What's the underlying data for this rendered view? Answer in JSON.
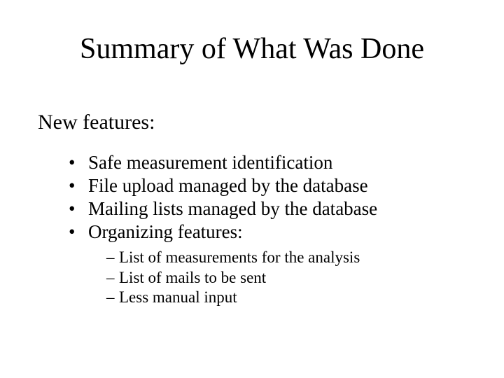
{
  "title": "Summary of What Was Done",
  "subtitle": "New features:",
  "bullets": [
    "Safe measurement identification",
    "File upload managed by the database",
    "Mailing lists managed by the database",
    "Organizing features:"
  ],
  "sub_bullets": [
    "List of measurements for the analysis",
    "List of mails to be sent",
    "Less manual input"
  ],
  "marks": {
    "bullet": "•",
    "dash": "–"
  }
}
